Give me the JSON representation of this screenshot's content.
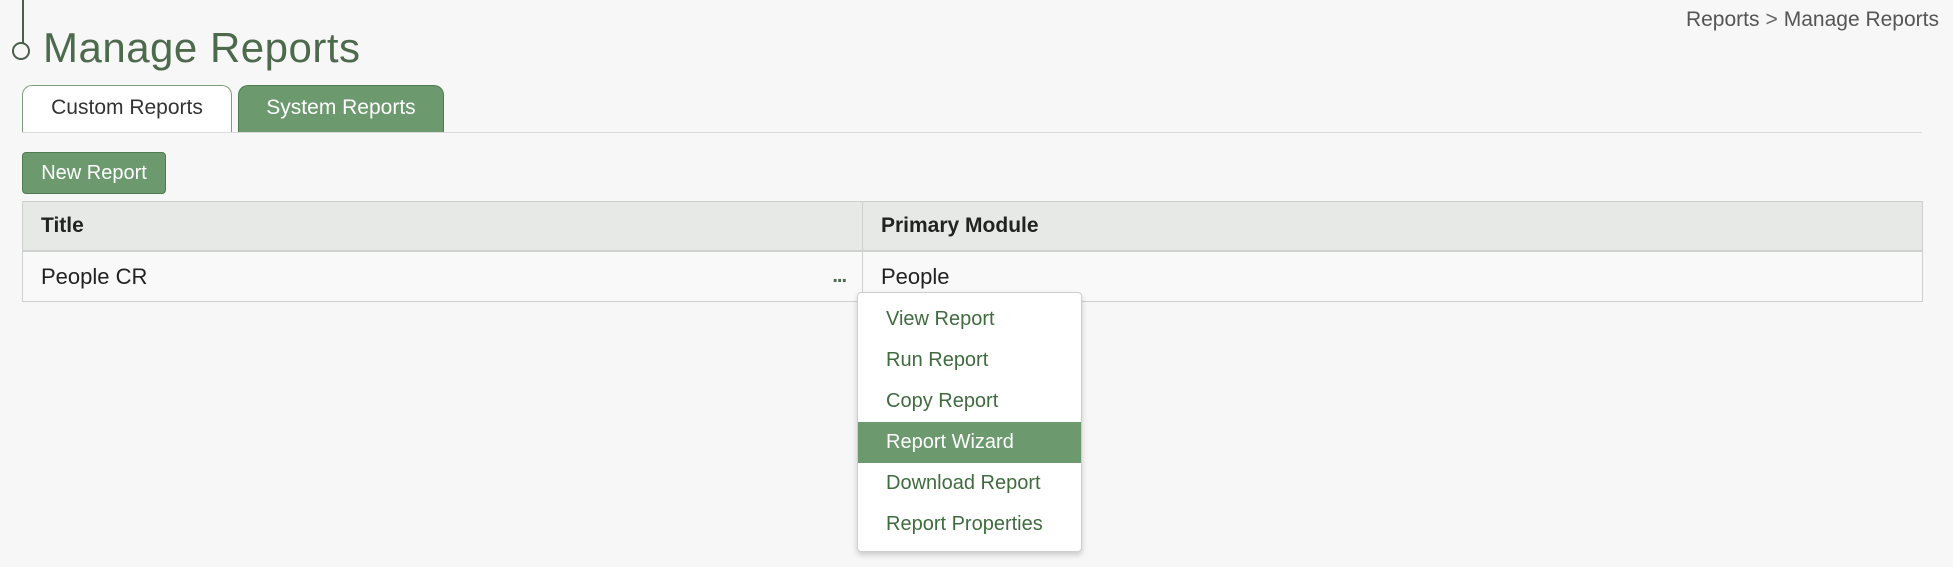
{
  "header": {
    "title": "Manage Reports",
    "breadcrumb": {
      "root": "Reports",
      "separator": ">",
      "current": "Manage Reports"
    }
  },
  "tabs": [
    {
      "label": "Custom Reports",
      "active": true
    },
    {
      "label": "System Reports",
      "active": false
    }
  ],
  "toolbar": {
    "new_report_label": "New Report"
  },
  "table": {
    "columns": [
      "Title",
      "Primary Module"
    ],
    "rows": [
      {
        "title": "People CR",
        "primary_module": "People",
        "menu_trigger": "..."
      }
    ]
  },
  "row_menu": {
    "items": [
      {
        "label": "View Report"
      },
      {
        "label": "Run Report"
      },
      {
        "label": "Copy Report"
      },
      {
        "label": "Report Wizard",
        "highlighted": true
      },
      {
        "label": "Download Report"
      },
      {
        "label": "Report Properties"
      }
    ]
  },
  "colors": {
    "accent": "#6c9a6e",
    "title": "#4d6a4d",
    "menu_text": "#3f6b3f"
  }
}
